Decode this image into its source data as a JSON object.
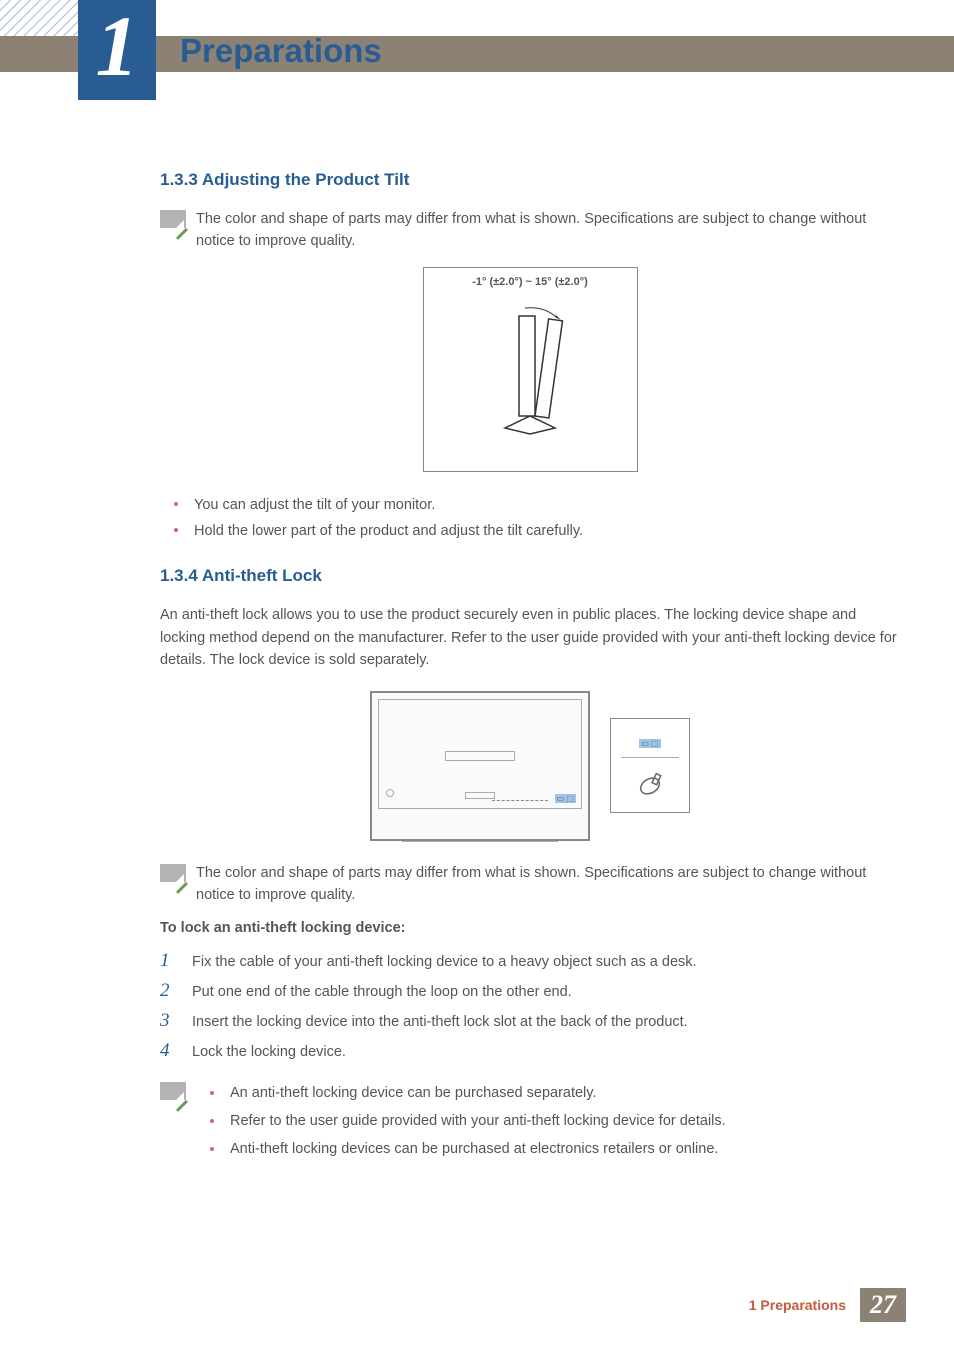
{
  "chapter": {
    "number": "1",
    "title": "Preparations"
  },
  "sections": {
    "tilt": {
      "heading": "1.3.3   Adjusting the Product Tilt",
      "note": "The color and shape of parts may differ from what is shown. Specifications are subject to change without notice to improve quality.",
      "tilt_range": "-1° (±2.0°) ~ 15° (±2.0°)",
      "bullets": [
        "You can adjust the tilt of your monitor.",
        "Hold the lower part of the product and adjust the tilt carefully."
      ]
    },
    "lock": {
      "heading": "1.3.4   Anti-theft Lock",
      "intro": "An anti-theft lock allows you to use the product securely even in public places. The locking device shape and locking method depend on the manufacturer. Refer to the user guide provided with your anti-theft locking device for details. The lock device is sold separately.",
      "note": "The color and shape of parts may differ from what is shown. Specifications are subject to change without notice to improve quality.",
      "steps_title": "To lock an anti-theft locking device:",
      "steps": [
        "Fix the cable of your anti-theft locking device to a heavy object such as a desk.",
        "Put one end of the cable through the loop on the other end.",
        "Insert the locking device into the anti-theft lock slot at the back of the product.",
        "Lock the locking device."
      ],
      "sub_notes": [
        "An anti-theft locking device can be purchased separately.",
        "Refer to the user guide provided with your anti-theft locking device for details.",
        "Anti-theft locking devices can be purchased at electronics retailers or online."
      ]
    }
  },
  "footer": {
    "label": "1 Preparations",
    "page": "27"
  }
}
